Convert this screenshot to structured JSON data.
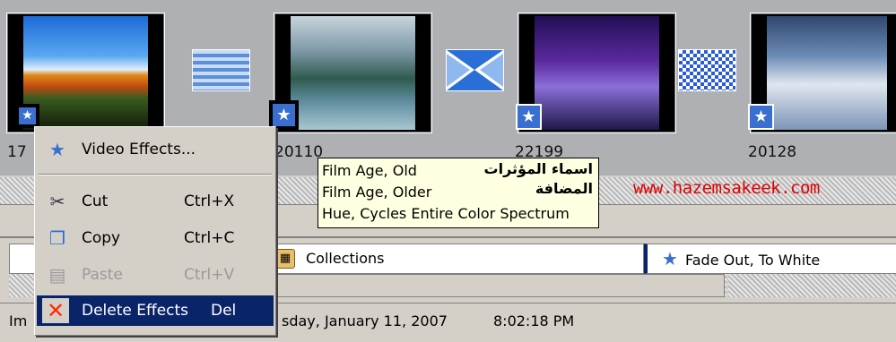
{
  "clips": [
    {
      "label": "17"
    },
    {
      "label": "20110"
    },
    {
      "label": "22199"
    },
    {
      "label": "20128"
    }
  ],
  "context_menu": {
    "video_effects": "Video Effects...",
    "cut": "Cut",
    "cut_shortcut": "Ctrl+X",
    "copy": "Copy",
    "copy_shortcut": "Ctrl+C",
    "paste": "Paste",
    "paste_shortcut": "Ctrl+V",
    "delete": "Delete Effects",
    "delete_shortcut": "Del"
  },
  "tooltip": {
    "effects": [
      "Film Age, Old",
      "Film Age, Older",
      "Hue, Cycles Entire Color Spectrum"
    ],
    "arabic_line1": "اسماء المؤثرات",
    "arabic_line2": "المضافة"
  },
  "watermark": "www.hazemsakeek.com",
  "collections_label": "Collections",
  "effect_panel_label": "Fade Out, To White",
  "status": {
    "left_fragment": "Im",
    "date": "sday, January 11, 2007",
    "time": "8:02:18 PM"
  },
  "colors": {
    "storyboard_bg": "#aeb0b4",
    "menu_highlight": "#0a246a",
    "tooltip_bg": "#ffffe1",
    "watermark": "#e00000"
  }
}
